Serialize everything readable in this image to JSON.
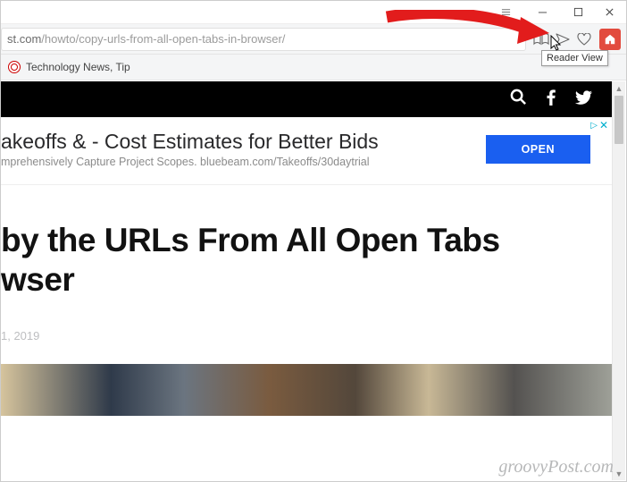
{
  "titlebar": {},
  "url": {
    "hostPart": "st.com",
    "pathPart": "/howto/copy-urls-from-all-open-tabs-in-browser/"
  },
  "tooltip": "Reader View",
  "bookmark": {
    "label": "Technology News, Tip"
  },
  "ad": {
    "headline": "akeoffs & - Cost Estimates for Better Bids",
    "sub": "mprehensively Capture Project Scopes. bluebeam.com/Takeoffs/30daytrial",
    "button": "OPEN",
    "choices": "▷"
  },
  "article": {
    "title": "by the URLs From All Open Tabs\nwser",
    "date": "1, 2019"
  },
  "watermark": "groovyPost.com"
}
